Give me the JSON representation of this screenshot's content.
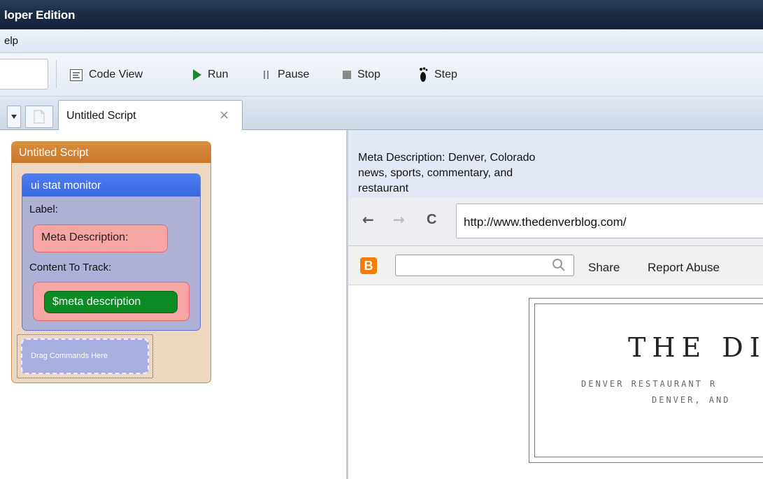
{
  "window": {
    "title": "loper Edition"
  },
  "menu": {
    "items": [
      "elp"
    ]
  },
  "toolbar": {
    "code_view": "Code View",
    "run": "Run",
    "pause": "Pause",
    "stop": "Stop",
    "step": "Step"
  },
  "tabs": [
    {
      "label": "Untitled Script",
      "close": "×"
    }
  ],
  "script": {
    "title": "Untitled Script",
    "command": {
      "title": "ui stat monitor",
      "label_caption": "Label:",
      "label_value": "Meta Description:",
      "content_caption": "Content To Track:",
      "content_value": "$meta description"
    },
    "dropzone": "Drag Commands Here"
  },
  "monitor_output": {
    "text": "Meta Description: Denver, Colorado news, sports, commentary, and restaurant"
  },
  "browser": {
    "url": "http://www.thedenverblog.com/",
    "back": "←",
    "forward": "→",
    "reload": "C"
  },
  "blogger_bar": {
    "icon": "B",
    "links": [
      "Share",
      "Report Abuse"
    ]
  },
  "blog": {
    "title": "THE DI",
    "subtitle1": "DENVER RESTAURANT R",
    "subtitle2": "DENVER, AND"
  },
  "colors": {
    "script_header": "#d98d3e",
    "command_header": "#3a66de",
    "variable_pill": "#0c8a23",
    "label_slot": "#f6a4a4",
    "blogger_orange": "#f57d00"
  }
}
